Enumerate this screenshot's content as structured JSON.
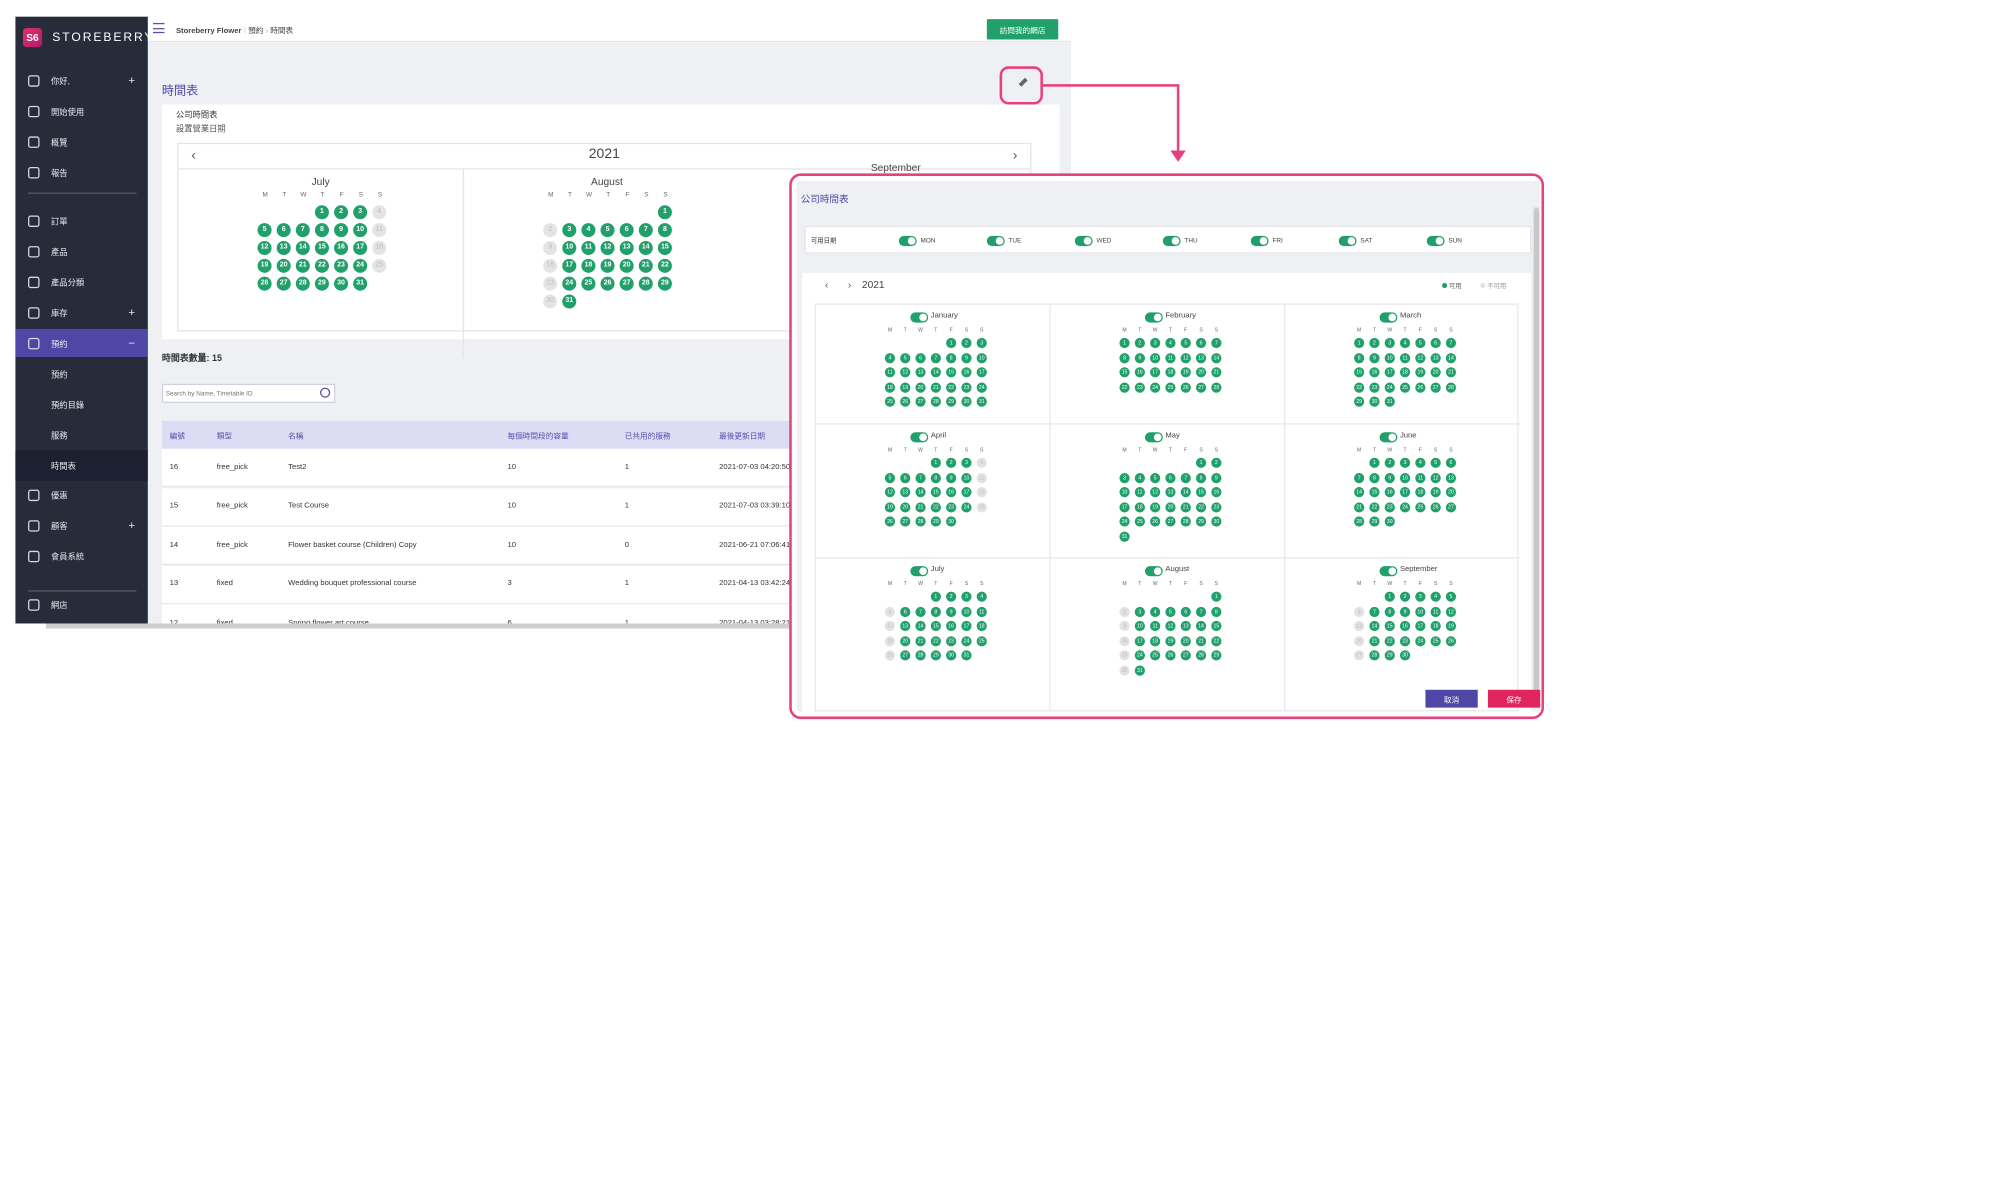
{
  "brand": {
    "logo_text": "S6",
    "name": "STOREBERRY"
  },
  "sidebar": {
    "items": [
      {
        "label": "你好,",
        "icon": "user-icon",
        "plus": "+"
      },
      {
        "label": "開始使用",
        "icon": "flag-icon"
      },
      {
        "label": "概覽",
        "icon": "chart-icon"
      },
      {
        "label": "報告",
        "icon": "file-icon"
      },
      {
        "label": "訂單",
        "icon": "cart-icon"
      },
      {
        "label": "產品",
        "icon": "box-icon"
      },
      {
        "label": "產品分類",
        "icon": "list-icon"
      },
      {
        "label": "庫存",
        "icon": "inventory-icon",
        "plus": "+"
      },
      {
        "label": "預約",
        "icon": "calendar-icon",
        "plus": "−"
      },
      {
        "label": "優惠",
        "icon": "ticket-icon"
      },
      {
        "label": "顧客",
        "icon": "customer-icon",
        "plus": "+"
      },
      {
        "label": "會員系統",
        "icon": "members-icon"
      },
      {
        "label": "網店",
        "icon": "store-icon"
      }
    ],
    "subitems": [
      "預約",
      "預約目錄",
      "服務",
      "時間表"
    ]
  },
  "topbar": {
    "shop": "Storeberry Flower",
    "crumb1": "預約",
    "crumb2": "時間表",
    "visit_button": "訪問我的網店"
  },
  "page": {
    "title": "時間表",
    "card_title": "公司時間表",
    "card_sub": "設置營業日期",
    "year": "2021",
    "prev": "‹",
    "next": "›"
  },
  "calendar": {
    "months": [
      "July",
      "August",
      "September"
    ],
    "dow": [
      "M",
      "T",
      "W",
      "T",
      "F",
      "S",
      "S"
    ]
  },
  "list": {
    "count_label": "時間表數量: 15",
    "search_placeholder": "Search by Name, Timetable ID",
    "headers": [
      "編號",
      "類型",
      "名稱",
      "每個時間段的容量",
      "已共用的服務",
      "最後更新日期"
    ],
    "rows": [
      [
        "16",
        "free_pick",
        "Test2",
        "10",
        "1",
        "2021-07-03 04:20:50"
      ],
      [
        "15",
        "free_pick",
        "Test Course",
        "10",
        "1",
        "2021-07-03 03:39:10"
      ],
      [
        "14",
        "free_pick",
        "Flower basket course (Children) Copy",
        "10",
        "0",
        "2021-06-21 07:06:41"
      ],
      [
        "13",
        "fixed",
        "Wedding bouquet professional course",
        "3",
        "1",
        "2021-04-13 03:42:24"
      ],
      [
        "12",
        "fixed",
        "Spring flower art course",
        "6",
        "1",
        "2021-04-13 03:28:21"
      ]
    ]
  },
  "modal": {
    "title": "公司時間表",
    "avail_label": "可用日期",
    "weekdays": [
      "MON",
      "TUE",
      "WED",
      "THU",
      "FRI",
      "SAT",
      "SUN"
    ],
    "year": "2021",
    "prev": "‹",
    "next": "›",
    "legend_on": "可用",
    "legend_off": "不可用",
    "months": [
      "January",
      "February",
      "March",
      "April",
      "May",
      "June",
      "July",
      "August",
      "September"
    ],
    "dow": [
      "M",
      "T",
      "W",
      "T",
      "F",
      "S",
      "S"
    ],
    "cancel": "取消",
    "save": "保存"
  },
  "colors": {
    "accent": "#4f47a6",
    "green": "#21a06b",
    "highlight": "#e4427e",
    "save": "#e0245e",
    "sidebar": "#272c3b"
  }
}
